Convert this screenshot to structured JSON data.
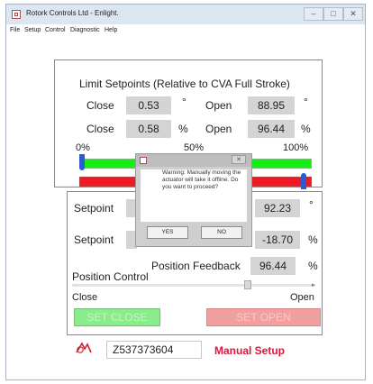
{
  "window": {
    "title": "Rotork Controls Ltd - Enlight.",
    "controls": {
      "minimize": "‒",
      "maximize": "□",
      "close": "✕"
    }
  },
  "menu": [
    "File",
    "Setup",
    "Control",
    "Diagnostic",
    "Help"
  ],
  "limits": {
    "heading": "Limit Setpoints (Relative to CVA Full Stroke)",
    "row1": {
      "close_label": "Close",
      "close_value": "0.53",
      "close_unit": "°",
      "open_label": "Open",
      "open_value": "88.95",
      "open_unit": "°"
    },
    "row2": {
      "close_label": "Close",
      "close_value": "0.58",
      "close_unit": "%",
      "open_label": "Open",
      "open_value": "96.44",
      "open_unit": "%"
    },
    "scale": [
      "0%",
      "50%",
      "100%"
    ]
  },
  "control": {
    "setpoint1": {
      "label": "Setpoint",
      "value": "92.23",
      "unit": "°"
    },
    "setpoint2": {
      "label": "Setpoint",
      "value": "-18.70",
      "unit": "%"
    },
    "feedback": {
      "label": "Position Feedback",
      "value": "96.44",
      "unit": "%"
    },
    "position_label": "Position Control",
    "slider": {
      "min_label": "Close",
      "max_label": "Open",
      "position_fraction": 0.73
    },
    "set_close": "SET CLOSE",
    "set_open": "SET OPEN"
  },
  "footer": {
    "serial": "Z537373604",
    "mode": "Manual Setup"
  },
  "dialog": {
    "message": "Warning: Manually moving the actuator will take it offline. Do you want to proceed?",
    "yes": "YES",
    "no": "NO"
  },
  "colors": {
    "green_bar": "#13ef13",
    "red_bar": "#ef1a24",
    "marker": "#2c5bd6",
    "mode_text": "#e0143c"
  }
}
